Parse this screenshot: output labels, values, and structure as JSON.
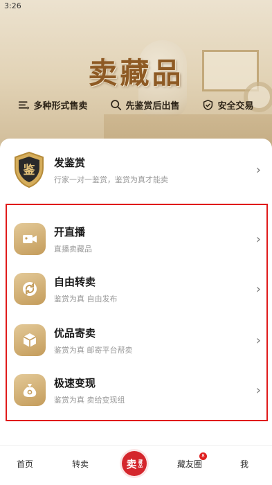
{
  "status_bar": {
    "time": "3:26"
  },
  "hero": {
    "title": "卖藏品",
    "features": [
      {
        "icon": "list-icon",
        "label": "多种形式售卖"
      },
      {
        "icon": "search-icon",
        "label": "先鉴赏后出售"
      },
      {
        "icon": "shield-check-icon",
        "label": "安全交易"
      }
    ]
  },
  "appraise": {
    "icon_text": "鉴",
    "title": "发鉴赏",
    "subtitle": "行家一对一鉴赏，鉴赏为真才能卖"
  },
  "options": [
    {
      "icon": "video-camera-icon",
      "title": "开直播",
      "subtitle": "直播卖藏品"
    },
    {
      "icon": "refresh-arrows-icon",
      "title": "自由转卖",
      "subtitle": "鉴赏为真 自由发布"
    },
    {
      "icon": "box-icon",
      "title": "优品寄卖",
      "subtitle": "鉴赏为真 邮寄平台帮卖"
    },
    {
      "icon": "money-bag-icon",
      "title": "极速变现",
      "subtitle": "鉴赏为真 卖给变现组"
    }
  ],
  "tabbar": {
    "home": "首页",
    "resell": "转卖",
    "center_main": "卖",
    "center_small": "藏品",
    "friends": "藏友圈",
    "friends_badge": "8",
    "me": "我"
  },
  "colors": {
    "accent_gold": "#c49c5b",
    "title_brown": "#8e5a24",
    "highlight_red": "#e01a1a",
    "center_tab_red": "#d4262c"
  }
}
